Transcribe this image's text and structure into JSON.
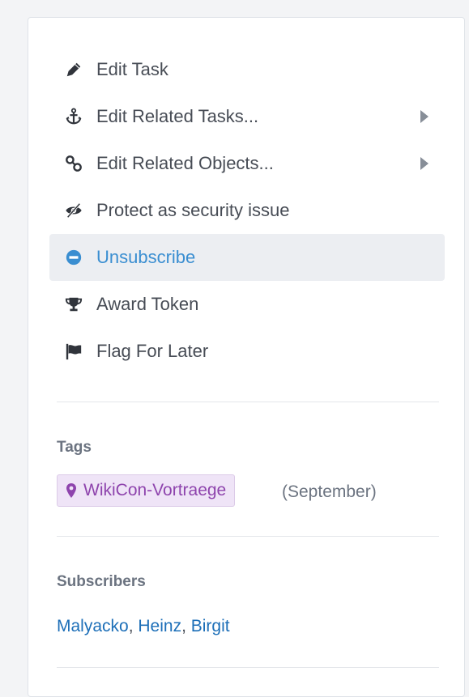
{
  "actions": [
    {
      "label": "Edit Task",
      "icon": "pencil-icon",
      "submenu": false
    },
    {
      "label": "Edit Related Tasks...",
      "icon": "anchor-icon",
      "submenu": true
    },
    {
      "label": "Edit Related Objects...",
      "icon": "link-icon",
      "submenu": true
    },
    {
      "label": "Protect as security issue",
      "icon": "eye-slash-icon",
      "submenu": false
    },
    {
      "label": "Unsubscribe",
      "icon": "minus-circle-icon",
      "submenu": false,
      "active": true
    },
    {
      "label": "Award Token",
      "icon": "trophy-icon",
      "submenu": false
    },
    {
      "label": "Flag For Later",
      "icon": "flag-icon",
      "submenu": false
    }
  ],
  "tags": {
    "title": "Tags",
    "items": [
      {
        "label": "WikiCon-Vortraege",
        "icon": "map-marker-icon",
        "note": "(September)"
      }
    ]
  },
  "subscribers": {
    "title": "Subscribers",
    "names": [
      "Malyacko",
      "Heinz",
      "Birgit"
    ],
    "separator": ", "
  },
  "colors": {
    "active_text": "#3a8ed1",
    "active_bg": "#eceef2",
    "tag_text": "#8e44ad",
    "tag_bg": "#efe4f7",
    "link": "#1d6fb8"
  }
}
